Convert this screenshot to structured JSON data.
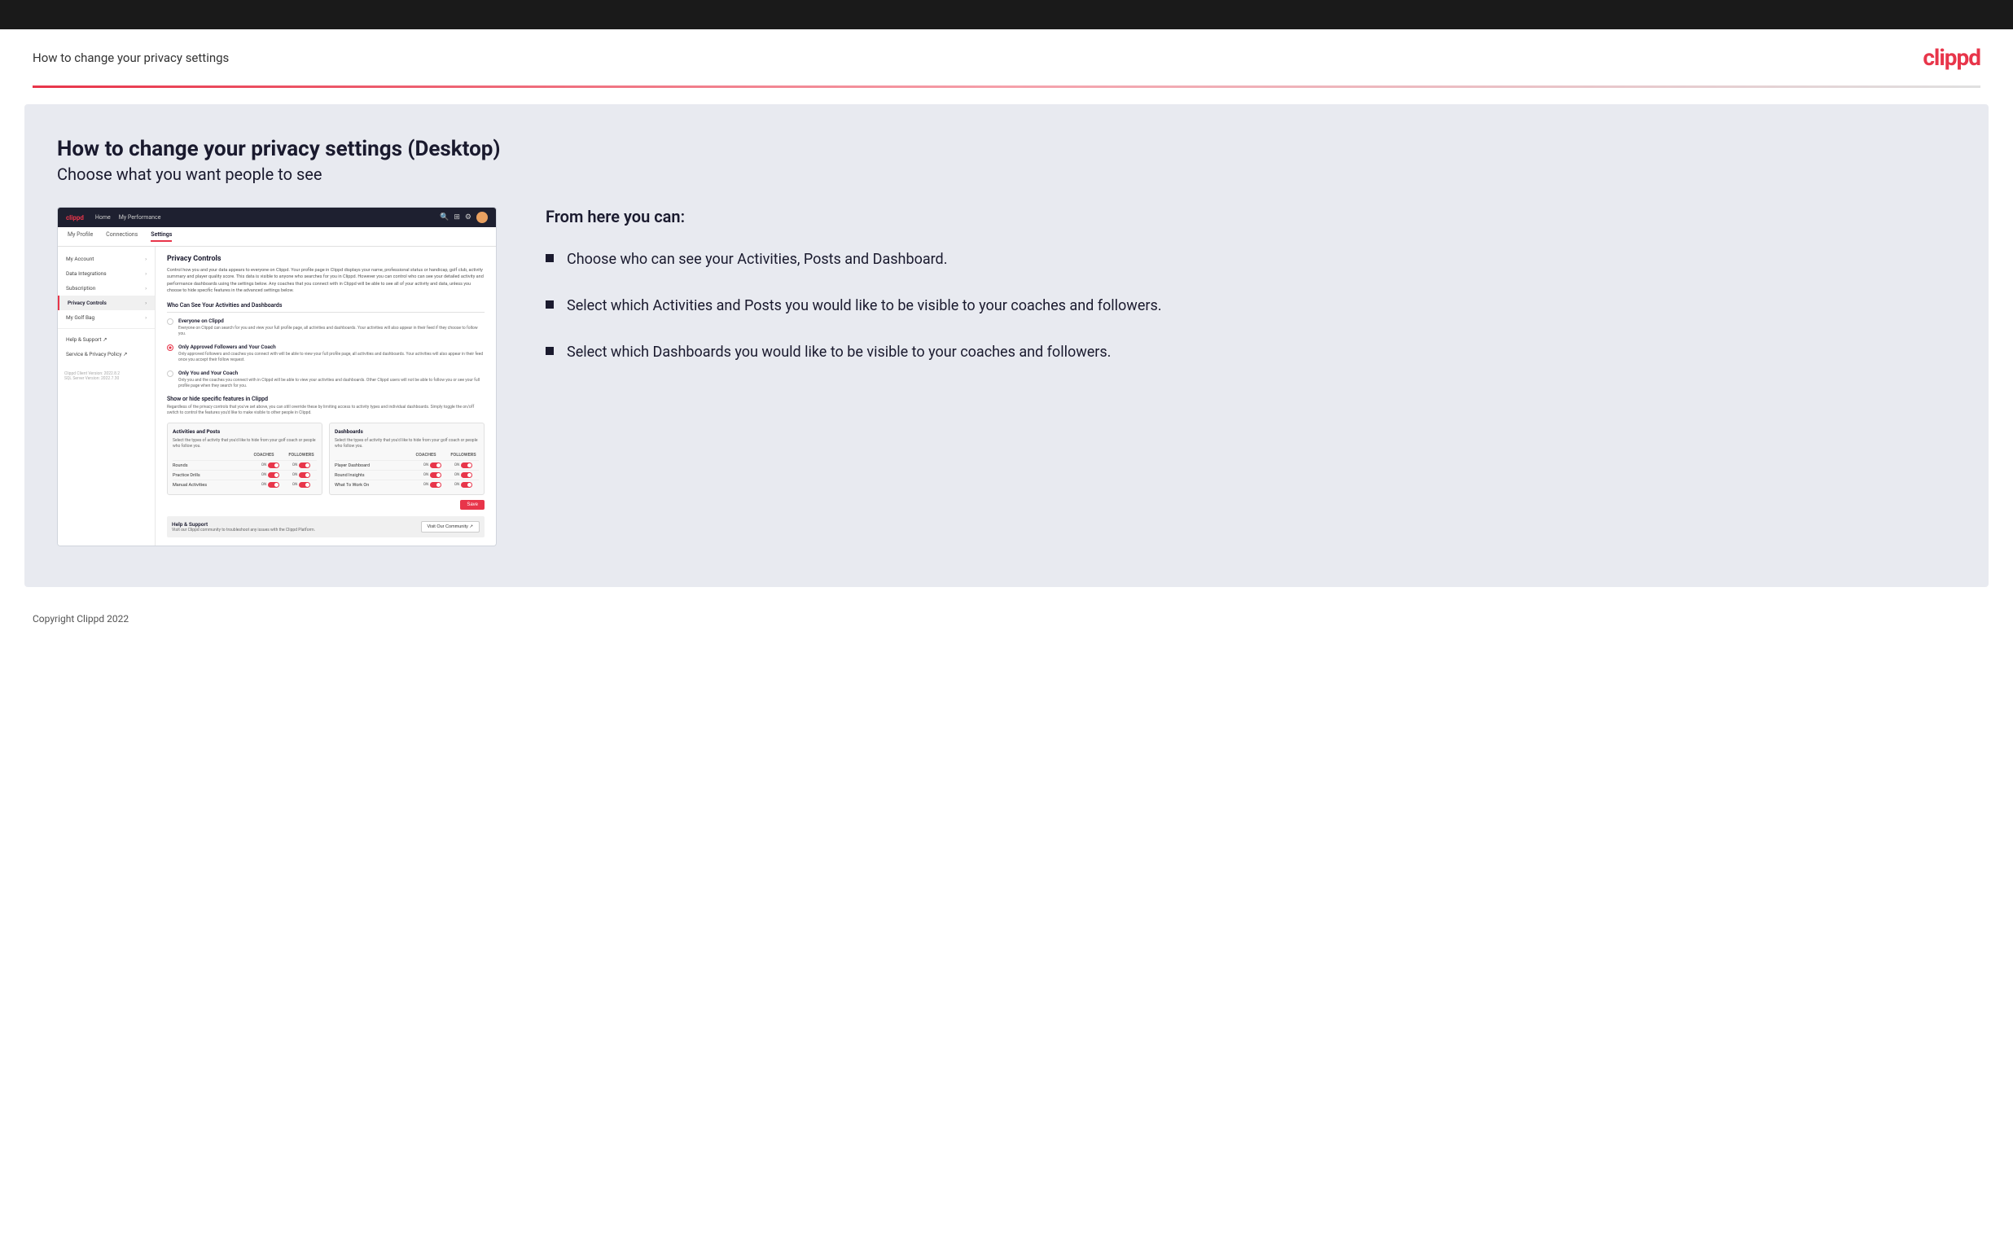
{
  "header": {
    "title": "How to change your privacy settings",
    "logo": "clippd"
  },
  "page": {
    "heading": "How to change your privacy settings (Desktop)",
    "subheading": "Choose what you want people to see"
  },
  "right_panel": {
    "intro": "From here you can:",
    "bullets": [
      "Choose who can see your Activities, Posts and Dashboard.",
      "Select which Activities and Posts you would like to be visible to your coaches and followers.",
      "Select which Dashboards you would like to be visible to your coaches and followers."
    ]
  },
  "app_mockup": {
    "nav": {
      "logo": "clippd",
      "links": [
        "Home",
        "My Performance"
      ]
    },
    "subnav": [
      "My Profile",
      "Connections",
      "Settings"
    ],
    "sidebar": {
      "items": [
        {
          "label": "My Account",
          "active": false
        },
        {
          "label": "Data Integrations",
          "active": false
        },
        {
          "label": "Subscription",
          "active": false
        },
        {
          "label": "Privacy Controls",
          "active": true
        },
        {
          "label": "My Golf Bag",
          "active": false
        },
        {
          "label": "Help & Support",
          "active": false
        },
        {
          "label": "Service & Privacy Policy",
          "active": false
        }
      ],
      "version": "Clippd Client Version: 2022.8.2\nSQL Server Version: 2022.7.30"
    },
    "main": {
      "panel_title": "Privacy Controls",
      "panel_desc": "Control how you and your data appears to everyone on Clippd. Your profile page in Clippd displays your name, professional status or handicap, golf club, activity summary and player quality score. This data is visible to anyone who searches for you in Clippd. However you can control who can see your detailed activity and performance dashboards using the settings below. Any coaches that you connect with in Clippd will be able to see all of your activity and data, unless you choose to hide specific features in the advanced settings below.",
      "who_section": {
        "title": "Who Can See Your Activities and Dashboards",
        "options": [
          {
            "id": "everyone",
            "label": "Everyone on Clippd",
            "desc": "Everyone on Clippd can search for you and view your full profile page, all activities and dashboards. Your activities will also appear in their feed if they choose to follow you.",
            "selected": false
          },
          {
            "id": "followers",
            "label": "Only Approved Followers and Your Coach",
            "desc": "Only approved followers and coaches you connect with will be able to view your full profile page, all activities and dashboards. Your activities will also appear in their feed once you accept their follow request.",
            "selected": true
          },
          {
            "id": "coach_only",
            "label": "Only You and Your Coach",
            "desc": "Only you and the coaches you connect with in Clippd will be able to view your activities and dashboards. Other Clippd users will not be able to follow you or see your full profile page when they search for you.",
            "selected": false
          }
        ]
      },
      "show_hide": {
        "title": "Show or hide specific features in Clippd",
        "desc": "Regardless of the privacy controls that you've set above, you can still override these by limiting access to activity types and individual dashboards. Simply toggle the on/off switch to control the features you'd like to make visible to other people in Clippd.",
        "activities": {
          "title": "Activities and Posts",
          "desc": "Select the types of activity that you'd like to hide from your golf coach or people who follow you.",
          "rows": [
            {
              "label": "Rounds"
            },
            {
              "label": "Practice Drills"
            },
            {
              "label": "Manual Activities"
            }
          ]
        },
        "dashboards": {
          "title": "Dashboards",
          "desc": "Select the types of activity that you'd like to hide from your golf coach or people who follow you.",
          "rows": [
            {
              "label": "Player Dashboard"
            },
            {
              "label": "Round Insights"
            },
            {
              "label": "What To Work On"
            }
          ]
        }
      },
      "save_label": "Save",
      "help": {
        "title": "Help & Support",
        "desc": "Visit our Clippd community to troubleshoot any issues with the Clippd Platform.",
        "button": "Visit Our Community"
      }
    }
  },
  "footer": {
    "copyright": "Copyright Clippd 2022"
  }
}
